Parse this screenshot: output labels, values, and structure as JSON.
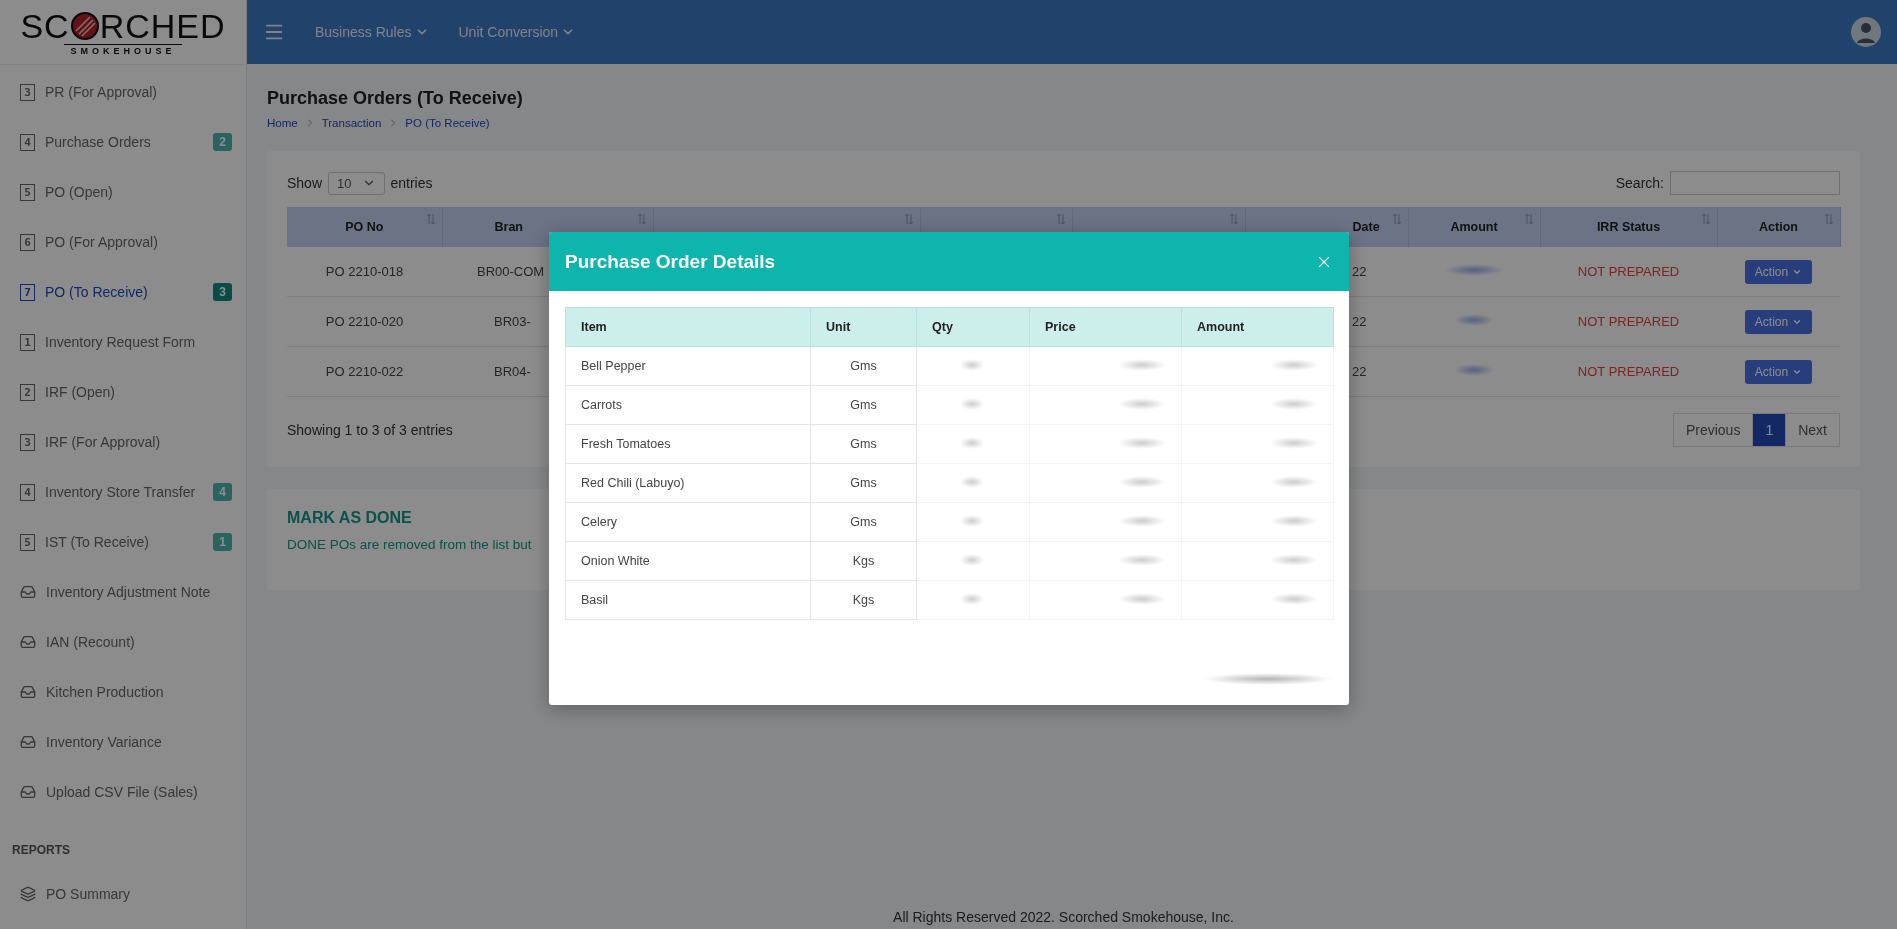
{
  "logo": {
    "before": "SC",
    "after": "RCHED",
    "tagline": "SMOKEHOUSE"
  },
  "sidebar": {
    "items": [
      {
        "kind": "numbered",
        "number": "3",
        "label": "PR (For Approval)",
        "selected": false
      },
      {
        "kind": "numbered",
        "number": "4",
        "label": "Purchase Orders",
        "badge": "2",
        "selected": false
      },
      {
        "kind": "numbered",
        "number": "5",
        "label": "PO (Open)",
        "selected": false
      },
      {
        "kind": "numbered",
        "number": "6",
        "label": "PO (For Approval)",
        "selected": false
      },
      {
        "kind": "numbered",
        "number": "7",
        "label": "PO (To Receive)",
        "badge": "3",
        "selected": true
      },
      {
        "kind": "numbered",
        "number": "1",
        "label": "Inventory Request Form",
        "selected": false
      },
      {
        "kind": "numbered",
        "number": "2",
        "label": "IRF (Open)",
        "selected": false
      },
      {
        "kind": "numbered",
        "number": "3",
        "label": "IRF (For Approval)",
        "selected": false
      },
      {
        "kind": "numbered",
        "number": "4",
        "label": "Inventory Store Transfer",
        "badge": "4",
        "selected": false
      },
      {
        "kind": "numbered",
        "number": "5",
        "label": "IST (To Receive)",
        "badge": "1",
        "selected": false
      },
      {
        "kind": "tray",
        "label": "Inventory Adjustment Note",
        "selected": false
      },
      {
        "kind": "tray",
        "label": "IAN (Recount)",
        "selected": false
      },
      {
        "kind": "tray",
        "label": "Kitchen Production",
        "selected": false
      },
      {
        "kind": "tray",
        "label": "Inventory Variance",
        "selected": false
      },
      {
        "kind": "tray",
        "label": "Upload CSV File (Sales)",
        "selected": false
      },
      {
        "kind": "heading",
        "label": "REPORTS"
      },
      {
        "kind": "layers",
        "label": "PO Summary",
        "selected": false
      }
    ]
  },
  "topbar": {
    "menus": [
      "Business Rules",
      "Unit Conversion"
    ]
  },
  "page": {
    "title": "Purchase Orders (To Receive)",
    "breadcrumb": [
      "Home",
      "Transaction",
      "PO (To Receive)"
    ]
  },
  "table": {
    "show": "Show",
    "page_size": "10",
    "entries": "entries",
    "search_label": "Search:",
    "columns": [
      {
        "label": "PO No",
        "sortable": true
      },
      {
        "label": "Bran",
        "sortable": true
      },
      {
        "sortable": true
      },
      {
        "sortable": true
      },
      {
        "sortable": true
      },
      {
        "label": "Date",
        "sortable": true
      },
      {
        "label": "Amount",
        "sortable": true
      },
      {
        "label": "IRR Status",
        "sortable": true
      },
      {
        "label": "Action",
        "sortable": true
      }
    ],
    "rows": [
      {
        "po_no": "PO 2210-018",
        "branch": "BR00-COM",
        "delivery_date": "22",
        "irr_status": "NOT PREPARED",
        "action": "Action"
      },
      {
        "po_no": "PO 2210-020",
        "branch": "BR03-",
        "delivery_date": "22",
        "irr_status": "NOT PREPARED",
        "action": "Action"
      },
      {
        "po_no": "PO 2210-022",
        "branch": "BR04-",
        "delivery_date": "22",
        "irr_status": "NOT PREPARED",
        "action": "Action"
      }
    ],
    "info": "Showing 1 to 3 of 3 entries",
    "pagination": [
      {
        "label": "Previous",
        "selected": false
      },
      {
        "label": "1",
        "selected": true
      },
      {
        "label": "Next",
        "selected": false
      }
    ]
  },
  "notice": {
    "title": "MARK AS DONE",
    "text": "DONE POs are removed from the list but"
  },
  "footer": "All Rights Reserved 2022. Scorched Smokehouse, Inc.",
  "modal": {
    "title": "Purchase Order Details",
    "columns": [
      "Item",
      "Unit",
      "Qty",
      "Price",
      "Amount"
    ],
    "rows": [
      {
        "item": "Bell Pepper",
        "unit": "Gms"
      },
      {
        "item": "Carrots",
        "unit": "Gms"
      },
      {
        "item": "Fresh Tomatoes",
        "unit": "Gms"
      },
      {
        "item": "Red Chili (Labuyo)",
        "unit": "Gms"
      },
      {
        "item": "Celery",
        "unit": "Gms"
      },
      {
        "item": "Onion White",
        "unit": "Kgs"
      },
      {
        "item": "Basil",
        "unit": "Kgs"
      }
    ]
  }
}
